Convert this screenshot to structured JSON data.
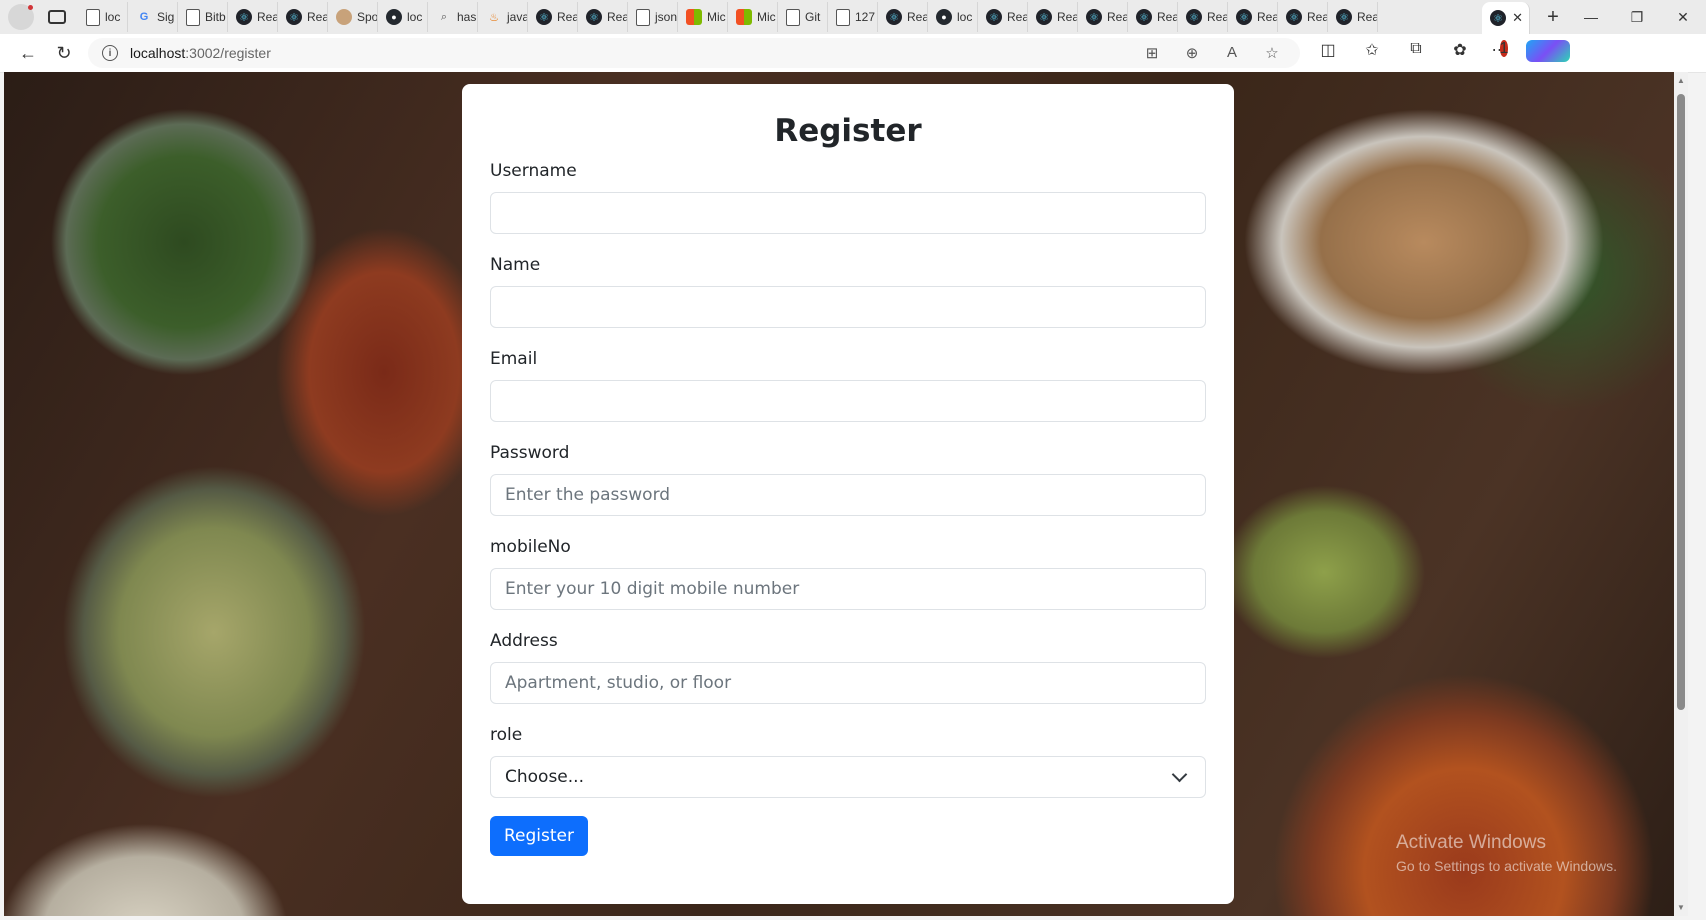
{
  "browser": {
    "tabs": [
      {
        "icon": "page",
        "label": "loc"
      },
      {
        "icon": "google",
        "label": "Sig"
      },
      {
        "icon": "page",
        "label": "Bitb"
      },
      {
        "icon": "react",
        "label": "Rea"
      },
      {
        "icon": "react",
        "label": "Rea"
      },
      {
        "icon": "spot",
        "label": "Spo"
      },
      {
        "icon": "gh",
        "label": "loc"
      },
      {
        "icon": "search",
        "label": "has"
      },
      {
        "icon": "java",
        "label": "java"
      },
      {
        "icon": "react",
        "label": "Rea"
      },
      {
        "icon": "react",
        "label": "Rea"
      },
      {
        "icon": "page",
        "label": "json"
      },
      {
        "icon": "ms",
        "label": "Mic"
      },
      {
        "icon": "ms",
        "label": "Mic"
      },
      {
        "icon": "page",
        "label": "Git"
      },
      {
        "icon": "page",
        "label": "127"
      },
      {
        "icon": "react",
        "label": "Rea"
      },
      {
        "icon": "gh",
        "label": "loc"
      },
      {
        "icon": "react",
        "label": "Rea"
      },
      {
        "icon": "react",
        "label": "Rea"
      },
      {
        "icon": "react",
        "label": "Rea"
      },
      {
        "icon": "react",
        "label": "Rea"
      },
      {
        "icon": "react",
        "label": "Rea"
      },
      {
        "icon": "react",
        "label": "Rea"
      },
      {
        "icon": "react",
        "label": "Rea"
      },
      {
        "icon": "react",
        "label": "Rea"
      }
    ],
    "active_tab_close": "✕",
    "new_tab": "+",
    "window_controls": {
      "minimize": "—",
      "restore": "❐",
      "close": "✕"
    },
    "url_host": "localhost",
    "url_path": ":3002/register",
    "notification_count": "1"
  },
  "form": {
    "title": "Register",
    "fields": {
      "username": {
        "label": "Username",
        "placeholder": ""
      },
      "name": {
        "label": "Name",
        "placeholder": ""
      },
      "email": {
        "label": "Email",
        "placeholder": ""
      },
      "password": {
        "label": "Password",
        "placeholder": "Enter the password"
      },
      "mobile": {
        "label": "mobileNo",
        "placeholder": "Enter your 10 digit mobile number"
      },
      "address": {
        "label": "Address",
        "placeholder": "Apartment, studio, or floor"
      },
      "role": {
        "label": "role",
        "selected": "Choose..."
      }
    },
    "submit_label": "Register",
    "accent_color": "#0d6efd"
  },
  "watermark": {
    "line1": "Activate Windows",
    "line2": "Go to Settings to activate Windows."
  }
}
